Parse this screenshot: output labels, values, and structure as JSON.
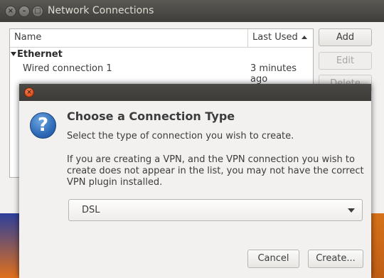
{
  "network_window": {
    "title": "Network Connections",
    "titlebar_buttons": [
      {
        "icon": "close-icon",
        "glyph": "×"
      },
      {
        "icon": "minimize-icon",
        "glyph": "–"
      },
      {
        "icon": "maximize-icon",
        "glyph": "□"
      }
    ],
    "columns": {
      "name": "Name",
      "last_used": "Last Used"
    },
    "groups": [
      {
        "label": "Ethernet",
        "connections": [
          {
            "name": "Wired connection 1",
            "last_used": "3 minutes ago"
          }
        ]
      }
    ],
    "buttons": {
      "add": "Add",
      "edit": "Edit",
      "delete": "Delete"
    }
  },
  "dialog": {
    "close_glyph": "×",
    "icon": "question-icon",
    "icon_glyph": "?",
    "heading": "Choose a Connection Type",
    "subtitle": "Select the type of connection you wish to create.",
    "info": "If you are creating a VPN, and the VPN connection you wish to create does not appear in the list, you may not have the correct VPN plugin installed.",
    "connection_type": {
      "selected": "DSL"
    },
    "buttons": {
      "cancel": "Cancel",
      "create": "Create..."
    }
  },
  "colors": {
    "titlebar": "#3c3b37",
    "close_button": "#df4a18",
    "question_icon": "#2f6bb8"
  }
}
